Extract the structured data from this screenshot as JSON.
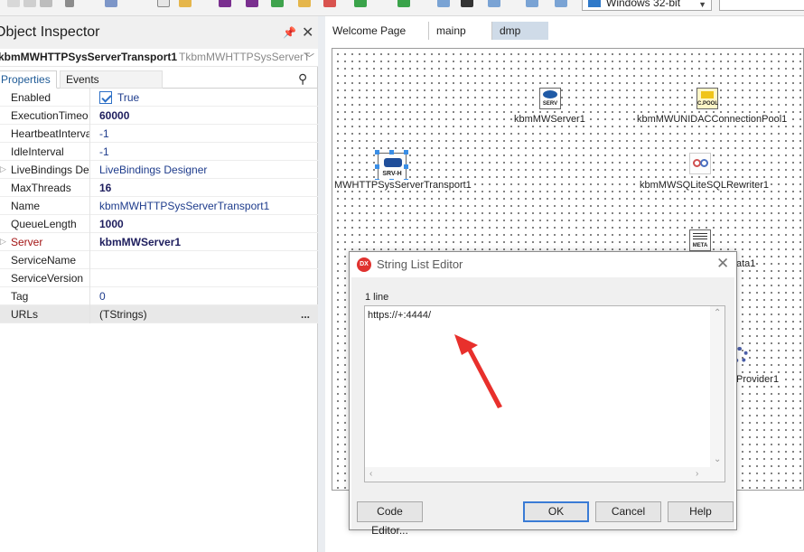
{
  "toolbar": {
    "platform": "Windows 32-bit"
  },
  "inspector": {
    "title": "Object Inspector",
    "component_name": "kbmMWHTTPSysServerTransport1",
    "component_type": "TkbmMWHTTPSysServerT",
    "tabs": [
      "Properties",
      "Events"
    ],
    "properties": [
      {
        "name": "Enabled",
        "value": "True"
      },
      {
        "name": "ExecutionTimeo",
        "value": "60000"
      },
      {
        "name": "HeartbeatInterva",
        "value": "-1"
      },
      {
        "name": "IdleInterval",
        "value": "-1"
      },
      {
        "name": "LiveBindings Des",
        "value": "LiveBindings Designer"
      },
      {
        "name": "MaxThreads",
        "value": "16"
      },
      {
        "name": "Name",
        "value": "kbmMWHTTPSysServerTransport1"
      },
      {
        "name": "QueueLength",
        "value": "1000"
      },
      {
        "name": "Server",
        "value": "kbmMWServer1"
      },
      {
        "name": "ServiceName",
        "value": ""
      },
      {
        "name": "ServiceVersion",
        "value": ""
      },
      {
        "name": "Tag",
        "value": "0"
      },
      {
        "name": "URLs",
        "value": "(TStrings)"
      }
    ],
    "ellipsis": "..."
  },
  "editor_tabs": [
    "Welcome Page",
    "mainp",
    "dmp"
  ],
  "components": {
    "server": {
      "label": "kbmMWServer1",
      "icon_text": "SERV"
    },
    "pool": {
      "label": "kbmMWUNIDACConnectionPool1",
      "icon_text": "C.POOL"
    },
    "transport": {
      "label": "MWHTTPSysServerTransport1",
      "icon_text": "SRV-H"
    },
    "rewriter": {
      "label": "kbmMWSQLiteSQLRewriter1"
    },
    "metadata": {
      "label": "ata1",
      "icon_text": "META"
    },
    "provider": {
      "label": "Provider1"
    }
  },
  "dialog": {
    "logo": "DX",
    "title": "String List Editor",
    "line_count": "1 line",
    "text": "https://+:4444/",
    "buttons": {
      "code_editor": "Code Editor...",
      "ok": "OK",
      "cancel": "Cancel",
      "help": "Help"
    }
  },
  "colors": {
    "accent": "#2c6fc6",
    "annotation_arrow": "#e8302c",
    "active_tab": "#cfdbe8"
  }
}
